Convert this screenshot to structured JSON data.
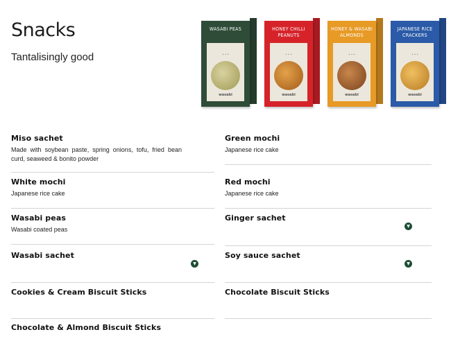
{
  "header": {
    "title": "Snacks",
    "subtitle": "Tantalisingly good"
  },
  "packs": [
    {
      "name": "WASABI PEAS",
      "color": "#2f4c38"
    },
    {
      "name": "HONEY CHILLI PEANUTS",
      "color": "#d6232a"
    },
    {
      "name": "HONEY & WASABI ALMONDS",
      "color": "#e79a25"
    },
    {
      "name": "JAPANESE RICE CRACKERS",
      "color": "#2b5aa8"
    }
  ],
  "items": [
    {
      "name": "Miso sachet",
      "desc": "Made with soybean paste, spring onions, tofu, fried bean curd, seaweed & bonito powder"
    },
    {
      "name": "Green mochi",
      "desc": "Japanese rice cake"
    },
    {
      "name": "White mochi",
      "desc": "Japanese rice cake"
    },
    {
      "name": "Red mochi",
      "desc": "Japanese rice cake"
    },
    {
      "name": "Wasabi peas",
      "desc": "Wasabi coated peas"
    },
    {
      "name": "Ginger sachet",
      "desc": ""
    },
    {
      "name": "Wasabi sachet",
      "desc": ""
    },
    {
      "name": "Soy sauce sachet",
      "desc": ""
    },
    {
      "name": "Cookies & Cream Biscuit Sticks",
      "desc": ""
    },
    {
      "name": "Chocolate Biscuit Sticks",
      "desc": ""
    },
    {
      "name": "Chocolate & Almond Biscuit Sticks",
      "desc": ""
    }
  ],
  "icons": {
    "expand": "chevron-down-icon"
  },
  "colors": {
    "accent": "#1e4d36"
  }
}
